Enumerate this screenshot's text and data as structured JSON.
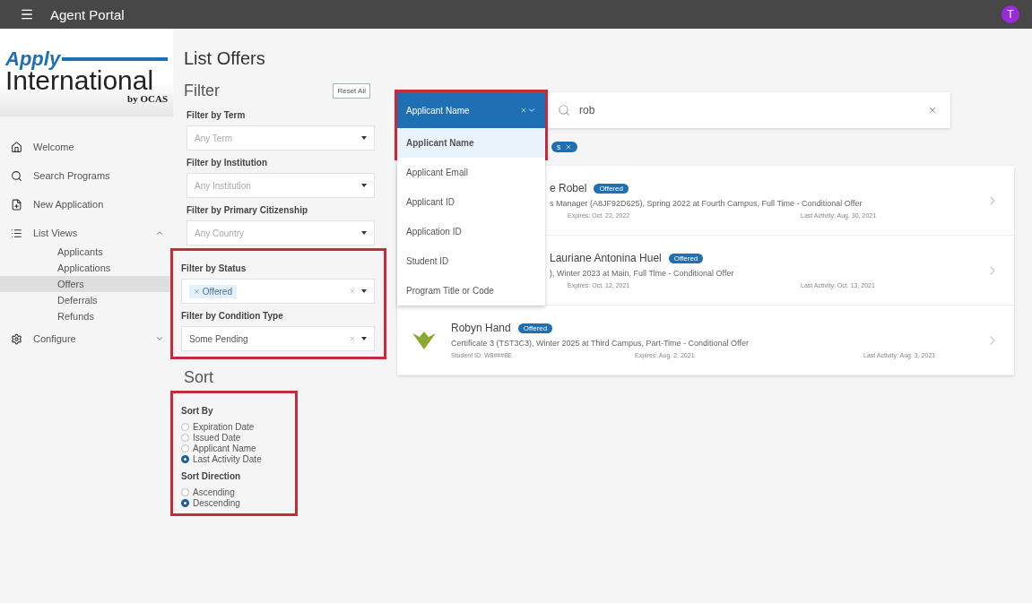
{
  "app_bar": {
    "title": "Agent Portal",
    "avatar": "T"
  },
  "logo": {
    "word1": "Apply",
    "word2": "International",
    "by": "by",
    "brand": "OCAS"
  },
  "sidebar": {
    "items": [
      {
        "label": "Welcome",
        "selected": false
      },
      {
        "label": "Search Programs",
        "selected": false
      },
      {
        "label": "New Application",
        "selected": false
      },
      {
        "label": "List Views",
        "selected": false,
        "expanded": true,
        "children": [
          {
            "label": "Applicants",
            "selected": false
          },
          {
            "label": "Applications",
            "selected": false
          },
          {
            "label": "Offers",
            "selected": true
          },
          {
            "label": "Deferrals",
            "selected": false
          },
          {
            "label": "Refunds",
            "selected": false
          }
        ]
      },
      {
        "label": "Configure",
        "selected": false,
        "expanded": false
      }
    ]
  },
  "page_title": "List Offers",
  "filter": {
    "heading": "Filter",
    "reset": "Reset All",
    "groups": [
      {
        "highlighted": false,
        "fields": [
          {
            "label": "Filter by Term",
            "placeholder": "Any Term"
          },
          {
            "label": "Filter by Institution",
            "placeholder": "Any Institution"
          },
          {
            "label": "Filter by Primary Citizenship",
            "placeholder": "Any Country"
          }
        ]
      },
      {
        "highlighted": true,
        "fields": [
          {
            "label": "Filter by Status",
            "chip": "Offered"
          },
          {
            "label": "Filter by Condition Type",
            "value": "Some Pending"
          }
        ]
      }
    ]
  },
  "sort": {
    "heading": "Sort",
    "highlighted": true,
    "groups": [
      {
        "label": "Sort By",
        "options": [
          {
            "label": "Expiration Date",
            "selected": false
          },
          {
            "label": "Issued Date",
            "selected": false
          },
          {
            "label": "Applicant Name",
            "selected": false
          },
          {
            "label": "Last Activity Date",
            "selected": true
          }
        ]
      },
      {
        "label": "Sort Direction",
        "options": [
          {
            "label": "Ascending",
            "selected": false
          },
          {
            "label": "Descending",
            "selected": true
          }
        ]
      }
    ]
  },
  "search": {
    "field_selector": {
      "value": "Applicant Name",
      "highlighted": true,
      "options": [
        {
          "label": "Applicant Name",
          "selected": true
        },
        {
          "label": "Applicant Email",
          "selected": false
        },
        {
          "label": "Applicant ID",
          "selected": false
        },
        {
          "label": "Application ID",
          "selected": false
        },
        {
          "label": "Student ID",
          "selected": false
        },
        {
          "label": "Program Title or Code",
          "selected": false
        }
      ]
    },
    "query": "rob",
    "chip": "s"
  },
  "results": [
    {
      "avatar": false,
      "name": "e Robel",
      "badge": "Offered",
      "description": "s Manager (A8JF92D625), Spring 2022 at Fourth Campus, Full Time - Conditional Offer",
      "expires": "Expires: Oct. 22, 2022",
      "last_activity": "Last Activity: Aug. 30, 2021"
    },
    {
      "avatar": false,
      "name": "Lauriane Antonina Huel",
      "badge": "Offered",
      "description": "), Winter 2023 at Main, Full Time - Conditional Offer",
      "expires": "Expires: Oct. 12, 2021",
      "last_activity": "Last Activity: Oct. 13, 2021"
    },
    {
      "avatar": true,
      "name": "Robyn Hand",
      "badge": "Offered",
      "description": "Certificate 3 (TST3C3), Winter 2025 at Third Campus, Part-Time - Conditional Offer",
      "student_id": "Student ID: W8###BE",
      "expires": "Expires: Aug. 2, 2021",
      "last_activity": "Last Activity: Aug. 3, 2021"
    }
  ]
}
